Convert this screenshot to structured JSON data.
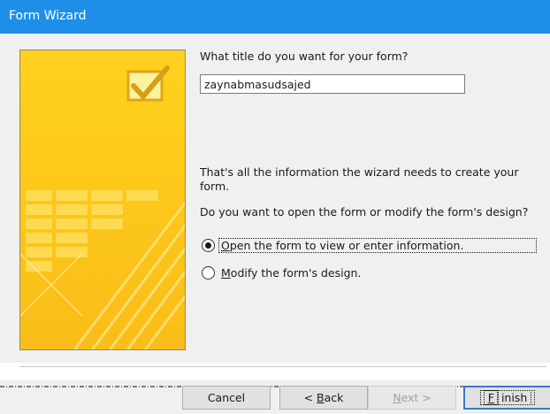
{
  "window": {
    "title": "Form Wizard"
  },
  "question_title": "What title do you want for your form?",
  "form_title_value": "zaynabmasudsajed",
  "info_text": "That's all the information the wizard needs to create your form.",
  "question_open": "Do you want to open the form or modify the form's design?",
  "options": [
    {
      "prefix": "",
      "accel": "O",
      "rest": "pen the form to view or enter information.",
      "selected": true
    },
    {
      "prefix": "",
      "accel": "M",
      "rest": "odify the form's design.",
      "selected": false
    }
  ],
  "buttons": {
    "cancel": {
      "label": "Cancel"
    },
    "back": {
      "prefix": "< ",
      "accel": "B",
      "rest": "ack"
    },
    "next": {
      "accel": "N",
      "rest": "ext >",
      "enabled": false
    },
    "finish": {
      "accel": "F",
      "rest": "inish"
    }
  },
  "colors": {
    "titlebar": "#1e8fe8",
    "panel": "#f0f0f0",
    "art_yellow": "#ffd11f",
    "check": "#d4a017"
  }
}
